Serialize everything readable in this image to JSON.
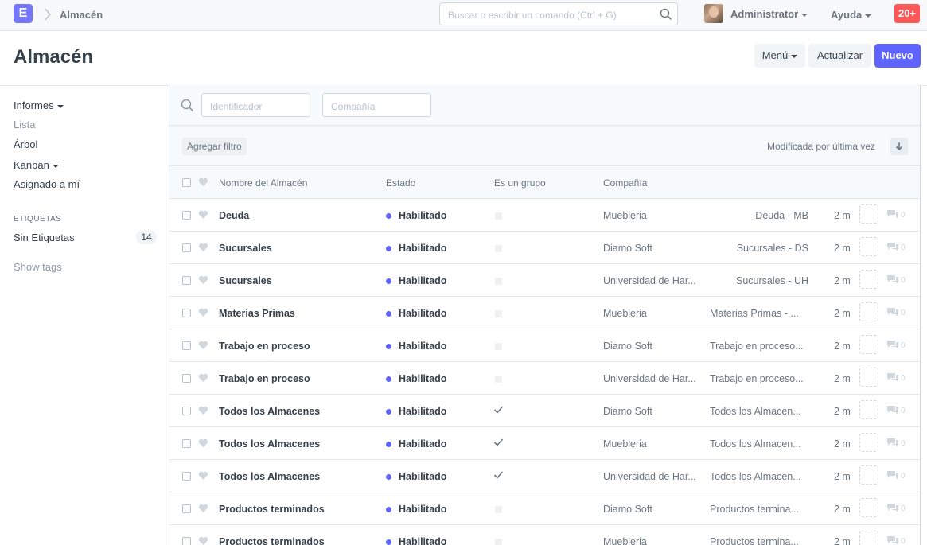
{
  "navbar": {
    "logo_letter": "E",
    "breadcrumb": "Almacén",
    "search_placeholder": "Buscar o escribir un comando (Ctrl + G)",
    "user_name": "Administrator",
    "help_label": "Ayuda",
    "notification_count": "20+"
  },
  "page": {
    "title": "Almacén",
    "menu_label": "Menú",
    "refresh_label": "Actualizar",
    "new_label": "Nuevo"
  },
  "sidebar": {
    "items": [
      "Informes",
      "Lista",
      "Árbol",
      "Kanban",
      "Asignado a mí"
    ],
    "tags_heading": "ETIQUETAS",
    "no_tags_label": "Sin Etiquetas",
    "no_tags_count": "14",
    "show_tags": "Show tags"
  },
  "filters": {
    "id_placeholder": "Identificador",
    "company_placeholder": "Compañía",
    "add_filter": "Agregar filtro",
    "sort_label": "Modificada por última vez"
  },
  "columns": {
    "name": "Nombre del Almacén",
    "status": "Estado",
    "is_group": "Es un grupo",
    "company": "Compañía"
  },
  "rows": [
    {
      "name": "Deuda",
      "status": "Habilitado",
      "is_group": false,
      "company": "Muebleria",
      "abbr": "Deuda - MB",
      "time": "2 m",
      "comments": "0"
    },
    {
      "name": "Sucursales",
      "status": "Habilitado",
      "is_group": false,
      "company": "Diamo Soft",
      "abbr": "Sucursales - DS",
      "time": "2 m",
      "comments": "0"
    },
    {
      "name": "Sucursales",
      "status": "Habilitado",
      "is_group": false,
      "company": "Universidad de Har...",
      "abbr": "Sucursales - UH",
      "time": "2 m",
      "comments": "0"
    },
    {
      "name": "Materias Primas",
      "status": "Habilitado",
      "is_group": false,
      "company": "Muebleria",
      "abbr": "Materias Primas - ...",
      "time": "2 m",
      "comments": "0"
    },
    {
      "name": "Trabajo en proceso",
      "status": "Habilitado",
      "is_group": false,
      "company": "Diamo Soft",
      "abbr": "Trabajo en proceso...",
      "time": "2 m",
      "comments": "0"
    },
    {
      "name": "Trabajo en proceso",
      "status": "Habilitado",
      "is_group": false,
      "company": "Universidad de Har...",
      "abbr": "Trabajo en proceso...",
      "time": "2 m",
      "comments": "0"
    },
    {
      "name": "Todos los Almacenes",
      "status": "Habilitado",
      "is_group": true,
      "company": "Diamo Soft",
      "abbr": "Todos los Almacen...",
      "time": "2 m",
      "comments": "0"
    },
    {
      "name": "Todos los Almacenes",
      "status": "Habilitado",
      "is_group": true,
      "company": "Muebleria",
      "abbr": "Todos los Almacen...",
      "time": "2 m",
      "comments": "0"
    },
    {
      "name": "Todos los Almacenes",
      "status": "Habilitado",
      "is_group": true,
      "company": "Universidad de Har...",
      "abbr": "Todos los Almacen...",
      "time": "2 m",
      "comments": "0"
    },
    {
      "name": "Productos terminados",
      "status": "Habilitado",
      "is_group": false,
      "company": "Diamo Soft",
      "abbr": "Productos termina...",
      "time": "2 m",
      "comments": "0"
    },
    {
      "name": "Productos terminados",
      "status": "Habilitado",
      "is_group": false,
      "company": "Muebleria",
      "abbr": "Productos termina...",
      "time": "2 m",
      "comments": "0"
    }
  ],
  "colors": {
    "accent": "#5e64ff",
    "logo": "#7575ff",
    "notification": "#ff5858"
  }
}
